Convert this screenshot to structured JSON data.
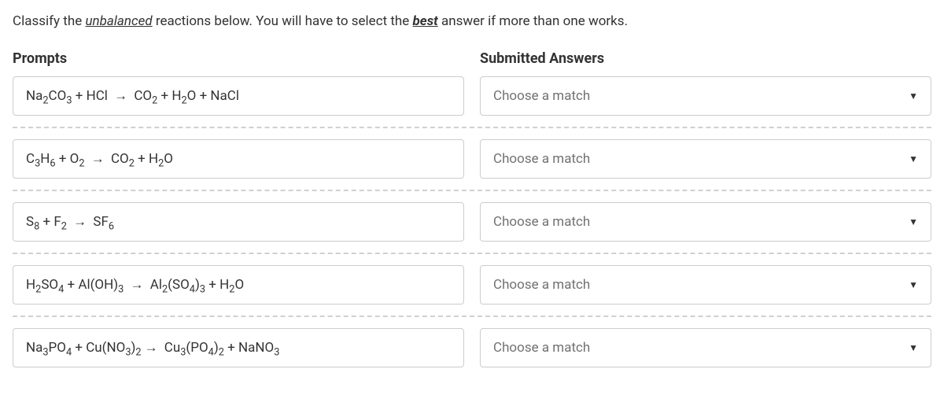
{
  "instruction": {
    "prefix": "Classify the ",
    "term1": "unbalanced",
    "middle": " reactions below. You will have to select the ",
    "term2": "best",
    "suffix": " answer if more than one works."
  },
  "headers": {
    "prompts": "Prompts",
    "answers": "Submitted Answers"
  },
  "rows": [
    {
      "prompt_html": "Na<span class='sub'>2</span>CO<span class='sub'>3</span> + HCl <span class='arrow'>→</span> CO<span class='sub'>2</span> + H<span class='sub'>2</span>O + NaCl",
      "answer": "Choose a match"
    },
    {
      "prompt_html": "C<span class='sub'>3</span>H<span class='sub'>6</span> + O<span class='sub'>2</span> <span class='arrow'>→</span> CO<span class='sub'>2</span> + H<span class='sub'>2</span>O",
      "answer": "Choose a match"
    },
    {
      "prompt_html": "S<span class='sub'>8</span> + F<span class='sub'>2</span> <span class='arrow'>→</span> SF<span class='sub'>6</span>",
      "answer": "Choose a match"
    },
    {
      "prompt_html": "H<span class='sub'>2</span>SO<span class='sub'>4</span> + Al(OH)<span class='sub'>3</span> <span class='arrow'>→</span> Al<span class='sub'>2</span>(SO<span class='sub'>4</span>)<span class='sub'>3</span> + H<span class='sub'>2</span>O",
      "answer": "Choose a match"
    },
    {
      "prompt_html": "Na<span class='sub'>3</span>PO<span class='sub'>4</span> + Cu(NO<span class='sub'>3</span>)<span class='sub'>2</span><span class='arrow'>→</span> Cu<span class='sub'>3</span>(PO<span class='sub'>4</span>)<span class='sub'>2</span> + NaNO<span class='sub'>3</span>",
      "answer": "Choose a match"
    }
  ]
}
